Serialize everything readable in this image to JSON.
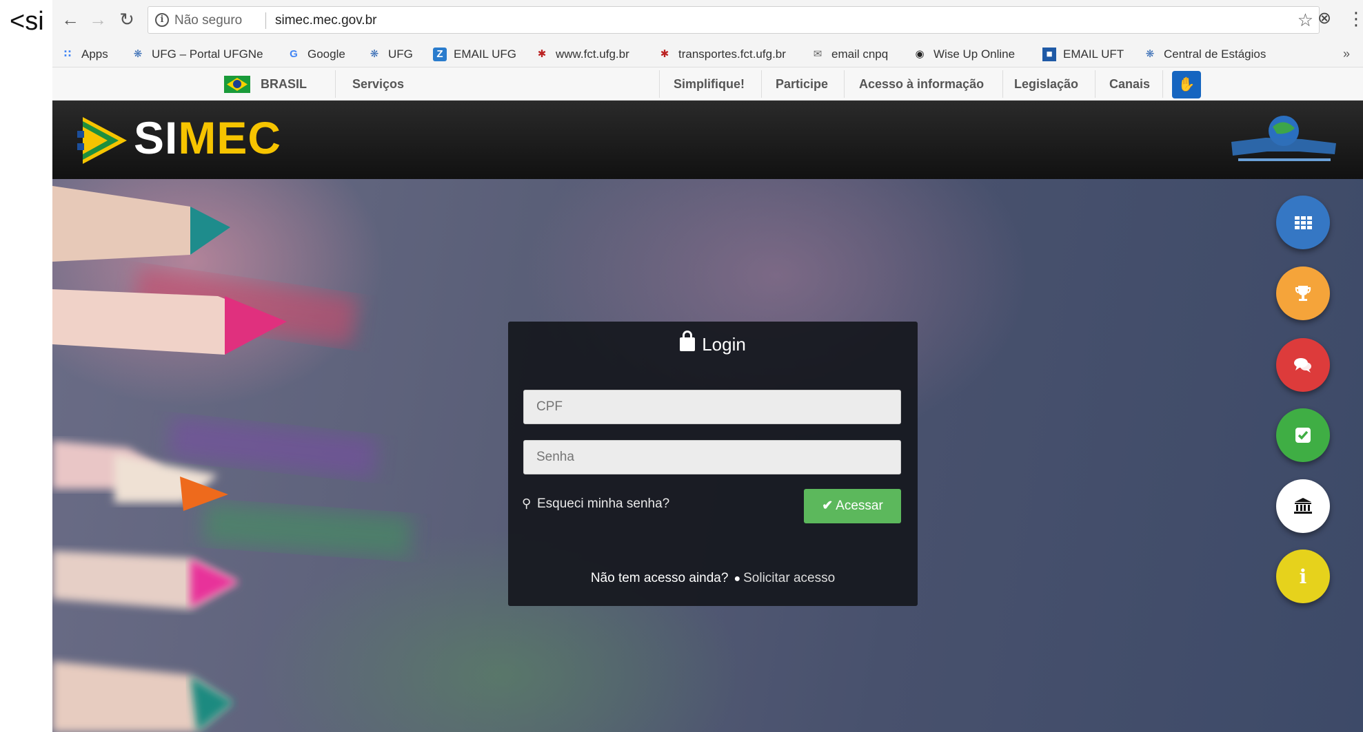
{
  "stray_text": "<si",
  "browser": {
    "security_label": "Não seguro",
    "url": "simec.mec.gov.br"
  },
  "bookmarks": [
    {
      "label": "Apps",
      "icon": "apps-grid-icon"
    },
    {
      "label": "UFG – Portal UFGNe",
      "icon": "ufg-icon"
    },
    {
      "label": "Google",
      "icon": "google-icon"
    },
    {
      "label": "UFG",
      "icon": "ufg-icon"
    },
    {
      "label": "EMAIL UFG",
      "icon": "z-icon"
    },
    {
      "label": "www.fct.ufg.br",
      "icon": "fct-icon"
    },
    {
      "label": "transportes.fct.ufg.br",
      "icon": "fct-icon"
    },
    {
      "label": "email cnpq",
      "icon": "envelope-icon"
    },
    {
      "label": "Wise Up Online",
      "icon": "wiseup-icon"
    },
    {
      "label": "EMAIL UFT",
      "icon": "uft-icon"
    },
    {
      "label": "Central de Estágios",
      "icon": "ufg-icon"
    }
  ],
  "gov_bar": {
    "brasil": "BRASIL",
    "servicos": "Serviços",
    "simplifique": "Simplifique!",
    "participe": "Participe",
    "acesso_informacao": "Acesso à informação",
    "legislacao": "Legislação",
    "canais": "Canais"
  },
  "header": {
    "logo_si": "SI",
    "logo_mec": "MEC"
  },
  "login": {
    "title": "Login",
    "cpf_placeholder": "CPF",
    "senha_placeholder": "Senha",
    "forgot": "Esqueci minha senha?",
    "submit": "Acessar",
    "no_access_question": "Não tem acesso ainda?",
    "request_access": "Solicitar acesso"
  },
  "side_buttons": [
    {
      "icon": "apps-grid-icon",
      "color": "#3577c4"
    },
    {
      "icon": "trophy-icon",
      "color": "#f5a43a"
    },
    {
      "icon": "chat-icon",
      "color": "#dd3b3b"
    },
    {
      "icon": "checkbox-icon",
      "color": "#3fae44"
    },
    {
      "icon": "bank-icon",
      "color": "#ffffff"
    },
    {
      "icon": "info-icon",
      "color": "#e6d21c",
      "glyph": "i"
    }
  ],
  "colors": {
    "accent_green": "#5cb85c",
    "logo_yellow": "#f6c400",
    "panel_bg": "#16181e"
  }
}
